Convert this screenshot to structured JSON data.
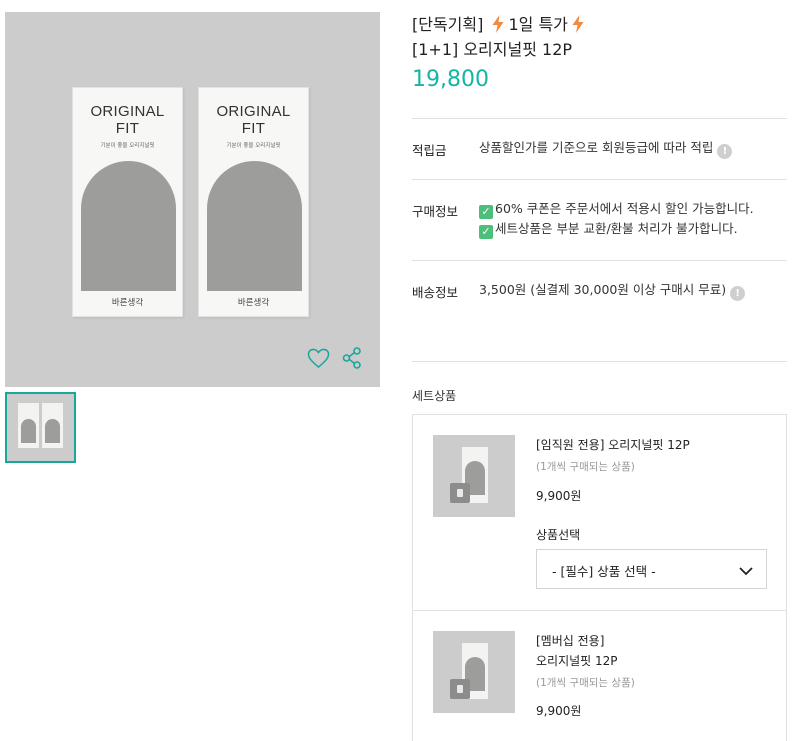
{
  "product": {
    "name_line1_prefix": "[단독기획]",
    "name_line1_suffix": "1일 특가",
    "name_line2": "[1+1] 오리지널핏 12P",
    "price": "19,800",
    "accent_color": "#14b5a5",
    "bolt_color": "#f08a3c"
  },
  "image": {
    "package_title_line1": "ORIGINAL",
    "package_title_line2": "FIT",
    "package_subtitle": "기분이 좋을 오리지널핏",
    "package_brand": "바른생각",
    "actions": [
      "heart-icon",
      "share-icon"
    ]
  },
  "details": {
    "points_label": "적립금",
    "points_value": "상품할인가를 기준으로 회원등급에 따라 적립",
    "purchase_label": "구매정보",
    "purchase_lines": [
      "60% 쿠폰은 주문서에서 적용시 할인 가능합니다.",
      "세트상품은 부분 교환/환불 처리가 불가합니다."
    ],
    "shipping_label": "배송정보",
    "shipping_value": "3,500원 (실결제 30,000원 이상 구매시 무료)"
  },
  "set": {
    "title": "세트상품",
    "items": [
      {
        "name": "[임직원 전용] 오리지널핏 12P",
        "note": "(1개씩 구매되는 상품)",
        "price": "9,900원",
        "select_label": "상품선택",
        "select_value": "- [필수] 상품 선택 -"
      },
      {
        "name_line1": "[멤버십 전용]",
        "name_line2": "오리지널핏 12P",
        "note": "(1개씩 구매되는 상품)",
        "price": "9,900원"
      }
    ]
  }
}
